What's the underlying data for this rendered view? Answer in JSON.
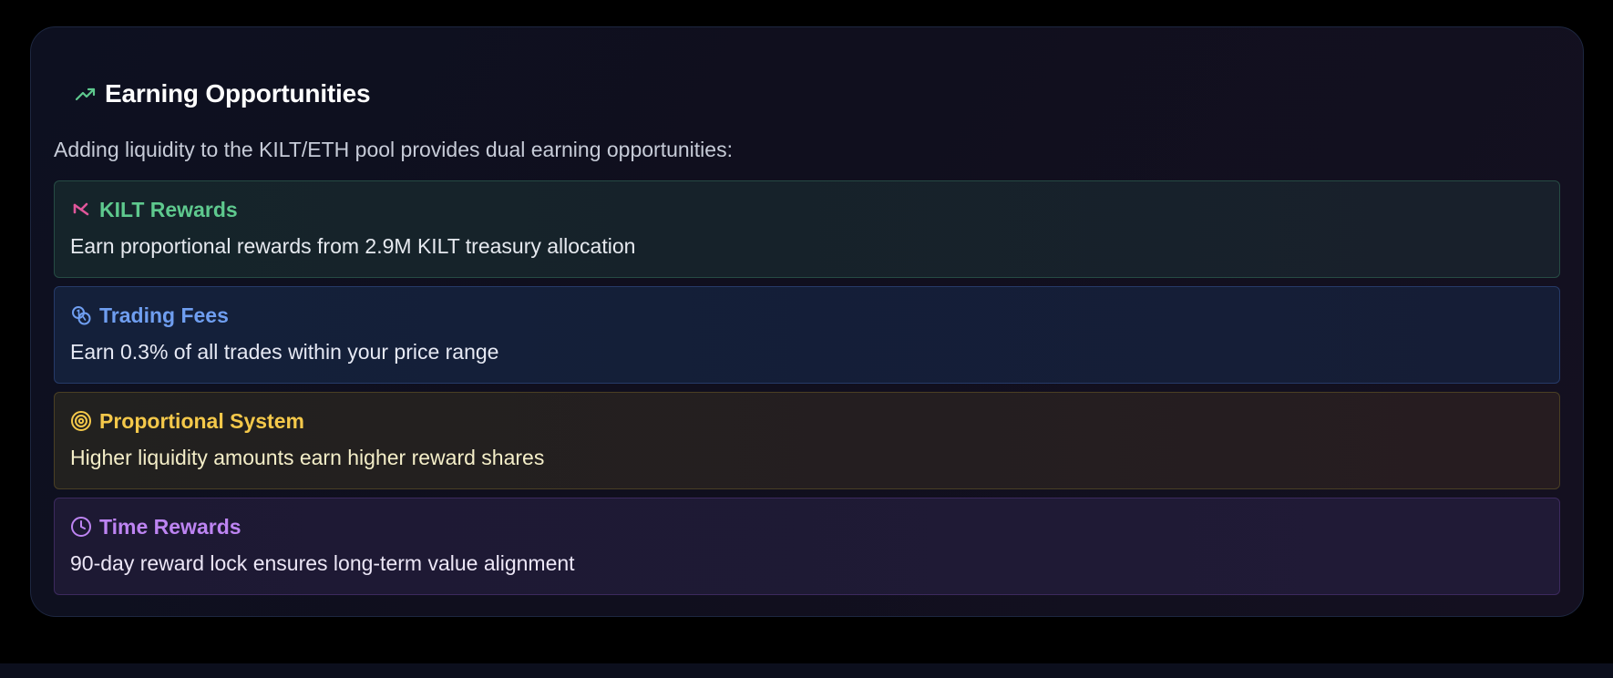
{
  "colors": {
    "accent_green": "#5ec98e",
    "accent_blue": "#6f9ef0",
    "accent_yellow": "#f4c84a",
    "accent_purple": "#bd84f2",
    "kilt_icon": "#e0569a"
  },
  "header": {
    "icon": "trending-up-icon",
    "title": "Earning Opportunities"
  },
  "intro": "Adding liquidity to the KILT/ETH pool provides dual earning opportunities:",
  "opportunities": [
    {
      "icon": "kilt-logo-icon",
      "title": "KILT Rewards",
      "description": "Earn proportional rewards from 2.9M KILT treasury allocation",
      "title_color": "#5ec98e",
      "desc_color": "#e6e9ef"
    },
    {
      "icon": "coins-icon",
      "title": "Trading Fees",
      "description": "Earn 0.3% of all trades within your price range",
      "title_color": "#6f9ef0",
      "desc_color": "#e6e9f4"
    },
    {
      "icon": "target-icon",
      "title": "Proportional System",
      "description": "Higher liquidity amounts earn higher reward shares",
      "title_color": "#f4c84a",
      "desc_color": "#f4eec8"
    },
    {
      "icon": "clock-icon",
      "title": "Time Rewards",
      "description": "90-day reward lock ensures long-term value alignment",
      "title_color": "#bd84f2",
      "desc_color": "#ece6f6"
    }
  ]
}
